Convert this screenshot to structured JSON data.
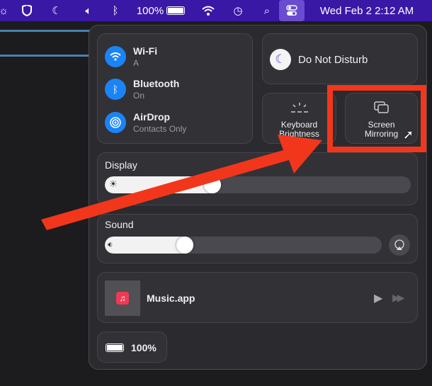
{
  "menubar": {
    "battery": "100%",
    "datetime": "Wed Feb 2  2:12 AM"
  },
  "control_center": {
    "wifi": {
      "label": "Wi-Fi",
      "status": "A"
    },
    "bluetooth": {
      "label": "Bluetooth",
      "status": "On"
    },
    "airdrop": {
      "label": "AirDrop",
      "status": "Contacts Only"
    },
    "dnd": {
      "label": "Do Not Disturb"
    },
    "keyboard": {
      "line1": "Keyboard",
      "line2": "Brightness"
    },
    "mirroring": {
      "line1": "Screen",
      "line2": "Mirroring"
    },
    "display": {
      "label": "Display",
      "level": 0.38
    },
    "sound": {
      "label": "Sound",
      "level": 0.32
    },
    "music": {
      "label": "Music.app"
    },
    "battery": {
      "label": "100%"
    }
  },
  "colors": {
    "menubar": "#3a18a6",
    "accent": "#1a84f5",
    "annotation": "#f2361c"
  }
}
